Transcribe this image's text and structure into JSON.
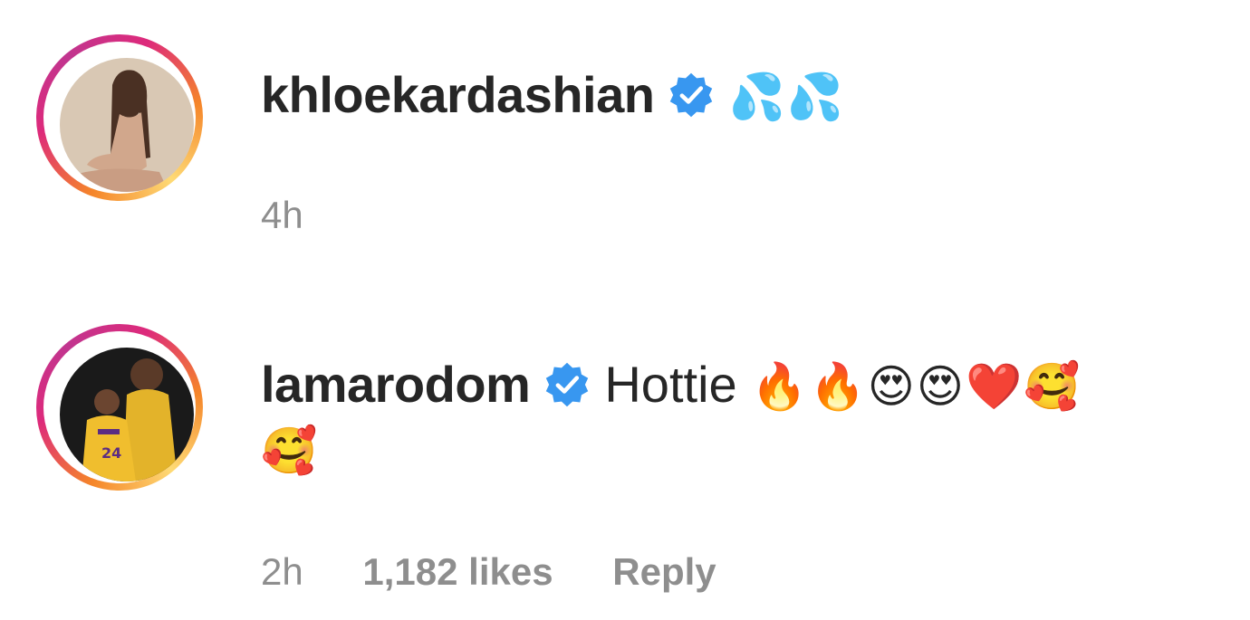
{
  "comments": [
    {
      "username": "khloekardashian",
      "verified": true,
      "text": "",
      "emoji": "💦💦",
      "emoji_line2": "",
      "time": "4h",
      "likes": "",
      "reply_label": ""
    },
    {
      "username": "lamarodom",
      "verified": true,
      "text": "Hottie",
      "emoji": "🔥🔥😍😍❤️🥰",
      "emoji_line2": "🥰",
      "time": "2h",
      "likes": "1,182 likes",
      "reply_label": "Reply"
    }
  ],
  "colors": {
    "verified_badge": "#3897f0",
    "meta_text": "#8e8e8e",
    "username_text": "#262626"
  }
}
